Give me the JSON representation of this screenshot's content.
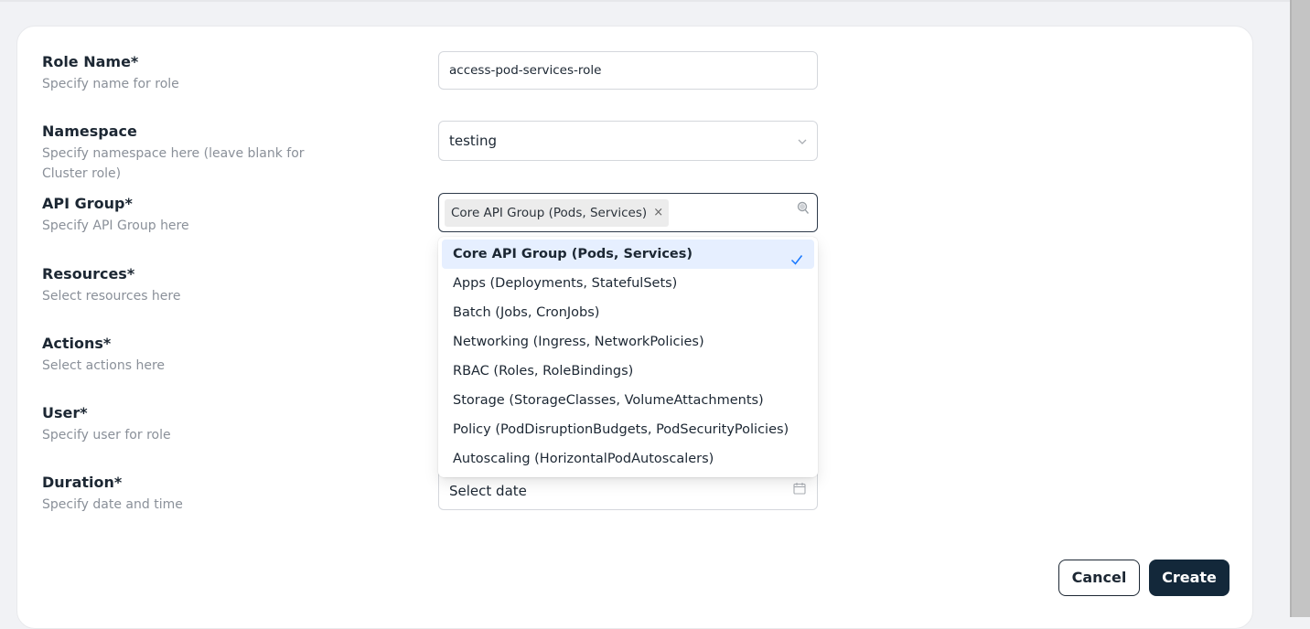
{
  "form": {
    "role_name": {
      "label": "Role Name*",
      "help": "Specify name for role",
      "value": "access-pod-services-role"
    },
    "namespace": {
      "label": "Namespace",
      "help": "Specify namespace here (leave blank for Cluster role)",
      "value": "testing"
    },
    "api_group": {
      "label": "API Group*",
      "help": "Specify API Group here",
      "selected_tag": "Core API Group (Pods, Services)",
      "tag_remove": "×"
    },
    "resources": {
      "label": "Resources*",
      "help": "Select resources here"
    },
    "actions": {
      "label": "Actions*",
      "help": "Select actions here"
    },
    "user": {
      "label": "User*",
      "help": "Specify user for role"
    },
    "duration": {
      "label": "Duration*",
      "help": "Specify date and time",
      "placeholder": "Select date"
    }
  },
  "api_group_options": [
    {
      "label": "Core API Group (Pods, Services)",
      "selected": true
    },
    {
      "label": "Apps (Deployments, StatefulSets)",
      "selected": false
    },
    {
      "label": "Batch (Jobs, CronJobs)",
      "selected": false
    },
    {
      "label": "Networking (Ingress, NetworkPolicies)",
      "selected": false
    },
    {
      "label": "RBAC (Roles, RoleBindings)",
      "selected": false
    },
    {
      "label": "Storage (StorageClasses, VolumeAttachments)",
      "selected": false
    },
    {
      "label": "Policy (PodDisruptionBudgets, PodSecurityPolicies)",
      "selected": false
    },
    {
      "label": "Autoscaling (HorizontalPodAutoscalers)",
      "selected": false
    }
  ],
  "buttons": {
    "cancel": "Cancel",
    "create": "Create"
  },
  "icons": {
    "namespace": "chevron-down-icon",
    "api_group": "search-icon",
    "duration": "calendar-icon",
    "selected_option": "check-icon"
  },
  "colors": {
    "primary": "#13283a",
    "selected_option_bg": "#e6efff",
    "check": "#1677ff"
  }
}
